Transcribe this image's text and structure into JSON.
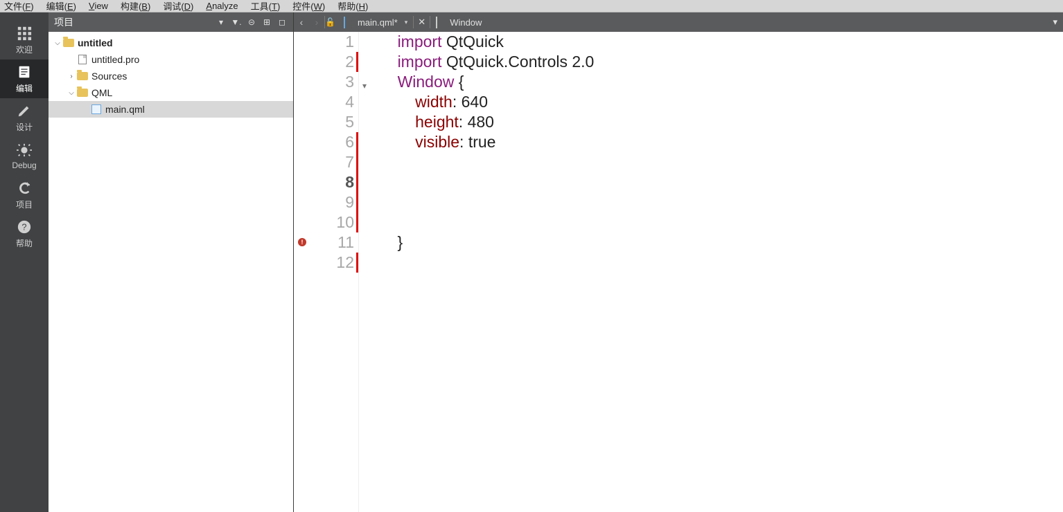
{
  "menubar": {
    "items": [
      {
        "label": "文件(F)",
        "u": "F"
      },
      {
        "label": "编辑(E)",
        "u": "E"
      },
      {
        "label": "View",
        "u": "V"
      },
      {
        "label": "构建(B)",
        "u": "B"
      },
      {
        "label": "调试(D)",
        "u": "D"
      },
      {
        "label": "Analyze",
        "u": "A"
      },
      {
        "label": "工具(T)",
        "u": "T"
      },
      {
        "label": "控件(W)",
        "u": "W"
      },
      {
        "label": "帮助(H)",
        "u": "H"
      }
    ]
  },
  "modebar": {
    "items": [
      {
        "id": "welcome",
        "label": "欢迎"
      },
      {
        "id": "edit",
        "label": "编辑",
        "active": true
      },
      {
        "id": "design",
        "label": "设计"
      },
      {
        "id": "debug",
        "label": "Debug"
      },
      {
        "id": "projects",
        "label": "项目"
      },
      {
        "id": "help",
        "label": "帮助"
      }
    ]
  },
  "projpanel": {
    "title": "项目",
    "tree": [
      {
        "depth": 0,
        "arrow": "down",
        "icon": "folder",
        "label": "untitled",
        "bold": true
      },
      {
        "depth": 1,
        "arrow": "blank",
        "icon": "file",
        "label": "untitled.pro"
      },
      {
        "depth": 1,
        "arrow": "right",
        "icon": "folder",
        "label": "Sources"
      },
      {
        "depth": 1,
        "arrow": "down",
        "icon": "folder",
        "label": "QML"
      },
      {
        "depth": 2,
        "arrow": "blank",
        "icon": "qml",
        "label": "main.qml",
        "selected": true
      }
    ]
  },
  "tabbar": {
    "file": "main.qml*",
    "secondary": "Window"
  },
  "code": {
    "current_line": 8,
    "lines": [
      {
        "n": 1,
        "red": false,
        "tokens": [
          {
            "t": "    "
          },
          {
            "t": "import",
            "c": "kw"
          },
          {
            "t": " QtQuick"
          }
        ]
      },
      {
        "n": 2,
        "red": true,
        "tokens": [
          {
            "t": "    "
          },
          {
            "t": "import",
            "c": "kw"
          },
          {
            "t": " QtQuick.Controls 2.0"
          }
        ]
      },
      {
        "n": 3,
        "red": false,
        "fold": true,
        "tokens": [
          {
            "t": "    "
          },
          {
            "t": "Window",
            "c": "kw"
          },
          {
            "t": " {"
          }
        ]
      },
      {
        "n": 4,
        "red": false,
        "tokens": [
          {
            "t": "        "
          },
          {
            "t": "width",
            "c": "prop"
          },
          {
            "t": ": 640"
          }
        ]
      },
      {
        "n": 5,
        "red": false,
        "tokens": [
          {
            "t": "        "
          },
          {
            "t": "height",
            "c": "prop"
          },
          {
            "t": ": 480"
          }
        ]
      },
      {
        "n": 6,
        "red": true,
        "tokens": [
          {
            "t": "        "
          },
          {
            "t": "visible",
            "c": "prop"
          },
          {
            "t": ": true"
          }
        ]
      },
      {
        "n": 7,
        "red": true,
        "tokens": [
          {
            "t": ""
          }
        ]
      },
      {
        "n": 8,
        "red": true,
        "tokens": [
          {
            "t": ""
          }
        ]
      },
      {
        "n": 9,
        "red": true,
        "tokens": [
          {
            "t": ""
          }
        ]
      },
      {
        "n": 10,
        "red": true,
        "tokens": [
          {
            "t": ""
          }
        ]
      },
      {
        "n": 11,
        "red": false,
        "err": true,
        "tokens": [
          {
            "t": "    }"
          }
        ]
      },
      {
        "n": 12,
        "red": true,
        "tokens": [
          {
            "t": ""
          }
        ]
      }
    ]
  }
}
